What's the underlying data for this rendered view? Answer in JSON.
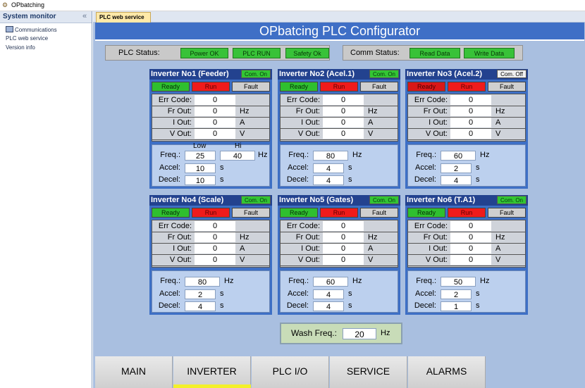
{
  "app": {
    "title": "OPbatching"
  },
  "sidebar": {
    "title": "System monitor",
    "collapse_glyph": "«",
    "items": [
      {
        "label": "Communications",
        "icon": "computer-icon"
      },
      {
        "label": "PLC web service"
      },
      {
        "label": "Version info"
      }
    ]
  },
  "tabs": [
    {
      "label": "PLC web service"
    }
  ],
  "page_title": "OPbatcing PLC Configurator",
  "plc_status": {
    "label": "PLC Status:",
    "indicators": [
      "Power OK",
      "PLC RUN",
      "Safety Ok"
    ]
  },
  "comm_status": {
    "label": "Comm Status:",
    "indicators": [
      "Read Data",
      "Write Data"
    ]
  },
  "common": {
    "ready": "Ready",
    "run": "Run",
    "fault": "Fault",
    "err_code": "Err Code:",
    "fr_out": "Fr Out:",
    "i_out": "I Out:",
    "v_out": "V Out:",
    "hz": "Hz",
    "a": "A",
    "v": "V",
    "s": "s",
    "freq": "Freq.:",
    "accel": "Accel:",
    "decel": "Decel:",
    "low": "Low",
    "hi": "Hi"
  },
  "inverters": [
    {
      "title": "Inverter No1 (Feeder)",
      "com": "Com. On",
      "err": "0",
      "fr": "0",
      "i": "0",
      "v": "0",
      "freq": "25",
      "freq_hi": "40",
      "accel": "10",
      "decel": "10"
    },
    {
      "title": "Inverter No2 (Acel.1)",
      "com": "Com. On",
      "err": "0",
      "fr": "0",
      "i": "0",
      "v": "0",
      "freq": "80",
      "accel": "4",
      "decel": "4"
    },
    {
      "title": "Inverter No3 (Acel.2)",
      "com": "Com. Off",
      "err": "0",
      "fr": "0",
      "i": "0",
      "v": "0",
      "freq": "60",
      "accel": "2",
      "decel": "4"
    },
    {
      "title": "Inverter No4 (Scale)",
      "com": "Com. On",
      "err": "0",
      "fr": "0",
      "i": "0",
      "v": "0",
      "freq": "80",
      "accel": "2",
      "decel": "4"
    },
    {
      "title": "Inverter No5 (Gates)",
      "com": "Com. On",
      "err": "0",
      "fr": "0",
      "i": "0",
      "v": "0",
      "freq": "60",
      "accel": "4",
      "decel": "4"
    },
    {
      "title": "Inverter No6 (T.A1)",
      "com": "Com. On",
      "err": "0",
      "fr": "0",
      "i": "0",
      "v": "0",
      "freq": "50",
      "accel": "2",
      "decel": "1"
    }
  ],
  "wash": {
    "label": "Wash Freq.:",
    "value": "20",
    "unit": "Hz"
  },
  "nav": [
    "MAIN",
    "INVERTER",
    "PLC I/O",
    "SERVICE",
    "ALARMS"
  ],
  "colors": {
    "banner": "#3f6fc6",
    "panel": "#a9bfe0",
    "green": "#38c238",
    "red": "#ef1b1b",
    "active_nav": "#f3f02a"
  }
}
